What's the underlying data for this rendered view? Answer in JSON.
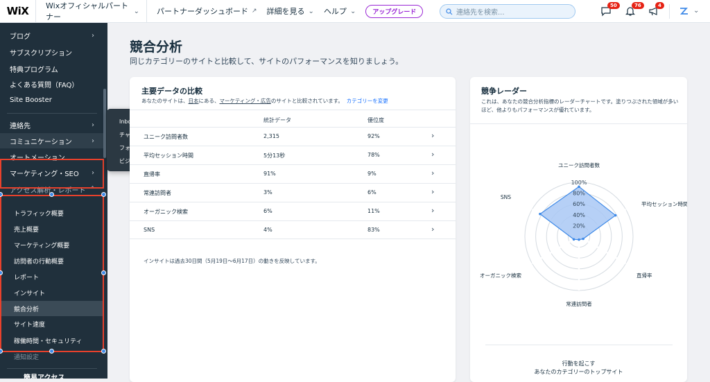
{
  "topbar": {
    "logo": "WiX",
    "site_name": "Wixオフィシャルパートナー",
    "nav": [
      "パートナーダッシュボード",
      "詳細を見る",
      "ヘルプ"
    ],
    "upgrade": "アップグレード",
    "search_placeholder": "連絡先を検索...",
    "badges": {
      "chat": "50",
      "bell": "76",
      "megaphone": "4"
    }
  },
  "sidebar": {
    "items": [
      {
        "label": "ブログ",
        "arrow": "›"
      },
      {
        "label": "サブスクリプション"
      },
      {
        "label": "特典プログラム"
      },
      {
        "label": "よくある質問（FAQ）"
      },
      {
        "label": "Site Booster"
      },
      {
        "label": "連絡先",
        "arrow": "›"
      },
      {
        "label": "コミュニケーション",
        "arrow": "›"
      },
      {
        "label": "オートメーション"
      },
      {
        "label": "マーケティング・SEO",
        "arrow": "›"
      },
      {
        "label": "アクセス解析・レポート",
        "arrow": "˄"
      }
    ],
    "sub_items": [
      "トラフィック概要",
      "売上概要",
      "マーケティング概要",
      "訪問者の行動概要",
      "レポート",
      "インサイト",
      "競合分析",
      "サイト速度",
      "稼働時間・セキュリティ",
      "通知設定"
    ],
    "bottom": "簡易アクセス"
  },
  "flyout": [
    "Inbox",
    "チャット",
    "フォーム・回答内容",
    "ビジネス用メール"
  ],
  "page": {
    "title": "競合分析",
    "subtitle": "同じカテゴリーのサイトと比較して、サイトのパフォーマンスを知りましょう。"
  },
  "comparison": {
    "title": "主要データの比較",
    "desc_prefix": "あなたのサイトは、",
    "desc_country": "日本",
    "desc_mid": "にある、",
    "desc_category": "マーケティング・広告",
    "desc_suffix": "のサイトと比較されています。",
    "change_link": "カテゴリーを変更",
    "headers": [
      "統計データ",
      "優位度"
    ],
    "rows": [
      {
        "metric": "ユニーク訪問者数",
        "stat": "2,315",
        "rank": "92%"
      },
      {
        "metric": "平均セッション時間",
        "stat": "5分13秒",
        "rank": "78%"
      },
      {
        "metric": "直帰率",
        "stat": "91%",
        "rank": "9%"
      },
      {
        "metric": "常連訪問者",
        "stat": "3%",
        "rank": "6%"
      },
      {
        "metric": "オーガニック検索",
        "stat": "6%",
        "rank": "11%"
      },
      {
        "metric": "SNS",
        "stat": "4%",
        "rank": "83%"
      }
    ],
    "note": "インサイトは過去30日間（5月19日〜6月17日）の動きを反映しています。"
  },
  "radar": {
    "title": "競争レーダー",
    "desc": "これは、あなたの競合分析指標のレーダーチャートです。塗りつぶされた領域が多いほど、他よりもパフォーマンスが優れています。",
    "cta_title": "行動を起こす",
    "cta_sub": "あなたのカテゴリーのトップサイト"
  },
  "chart_data": {
    "type": "radar",
    "axes": [
      "ユニーク訪問者数",
      "平均セッション時間",
      "直帰率",
      "常連訪問者",
      "オーガニック検索",
      "SNS"
    ],
    "values": [
      92,
      78,
      9,
      6,
      11,
      83
    ],
    "ticks": [
      "20%",
      "40%",
      "60%",
      "80%",
      "100%"
    ],
    "range": [
      0,
      100
    ],
    "fill_color": "#a9c8f5",
    "stroke_color": "#3f8ae8"
  },
  "colors": {
    "accent": "#116dff",
    "highlight": "#e8412c",
    "sidebar_bg": "#20303c",
    "upgrade": "#9a27d5"
  }
}
